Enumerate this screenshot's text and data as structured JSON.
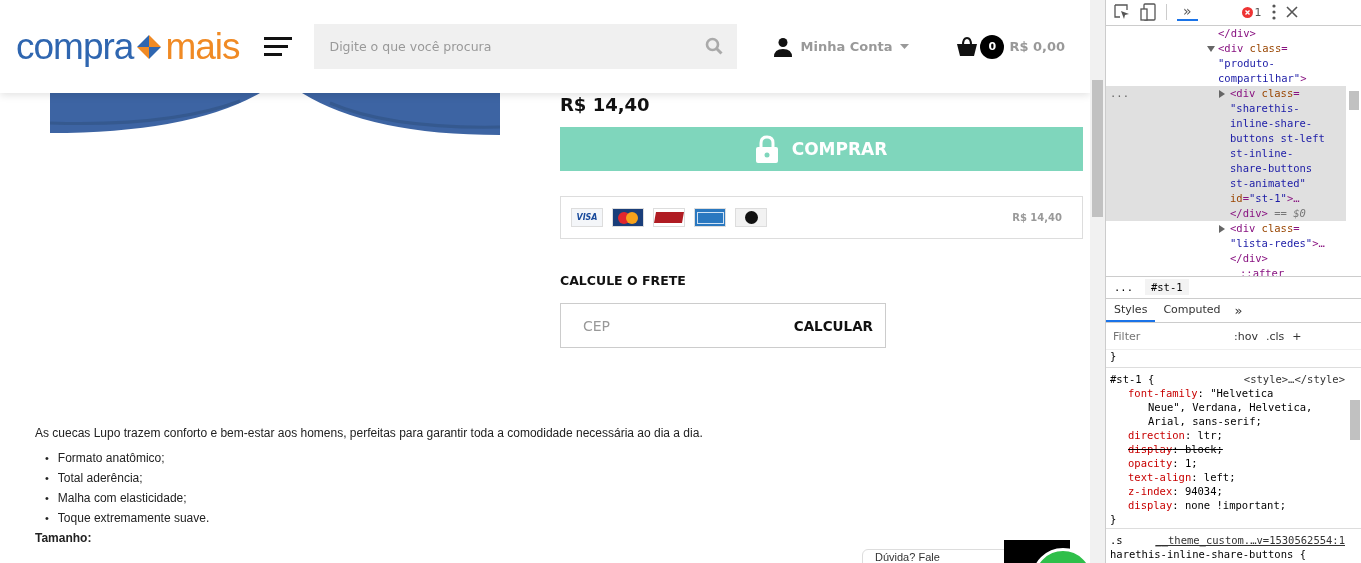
{
  "header": {
    "logo": {
      "left": "compra",
      "right": "mais"
    },
    "search": {
      "placeholder": "Digite o que você procura"
    },
    "account": {
      "label": "Minha Conta"
    },
    "cart": {
      "count": "0",
      "total": "R$ 0,00"
    }
  },
  "product": {
    "price": "R$ 14,40",
    "buy_button": "COMPRAR",
    "payment": {
      "cards": [
        {
          "kind": "visa",
          "label": "VISA"
        },
        {
          "kind": "mastercard"
        },
        {
          "kind": "hipercard"
        },
        {
          "kind": "amex"
        },
        {
          "kind": "elo"
        }
      ],
      "total": "R$ 14,40"
    },
    "shipping": {
      "title": "CALCULE O FRETE",
      "placeholder": "CEP",
      "button": "CALCULAR"
    }
  },
  "description": {
    "text": "As cuecas Lupo trazem conforto e bem-estar aos homens, perfeitas para garantir toda a comodidade necessária ao dia a dia.",
    "bullet": "•",
    "bullets": [
      "Formato anatômico;",
      "Total aderência;",
      "Malha com elasticidade;",
      "Toque extremamente suave."
    ],
    "size_label": "Tamanho:"
  },
  "chat": {
    "label": "Dúvida? Fale"
  },
  "devtools": {
    "more_tabs": "»",
    "error_count": "1",
    "row_menu": "...",
    "elements": [
      {
        "selected": false,
        "lines": [
          [
            {
              "kind": "tag",
              "t": "</div>"
            }
          ]
        ]
      },
      {
        "selected": false,
        "expanded": true,
        "lines": [
          [
            {
              "kind": "tag",
              "t": "<div "
            },
            {
              "kind": "attr",
              "t": "class"
            },
            {
              "kind": "tag",
              "t": "="
            }
          ],
          [
            {
              "kind": "val",
              "t": "\"produto-"
            }
          ],
          [
            {
              "kind": "val",
              "t": "compartilhar\""
            },
            {
              "kind": "tag",
              "t": ">"
            }
          ]
        ],
        "children": [
          {
            "selected": true,
            "expanded": false,
            "lines": [
              [
                {
                  "kind": "tag",
                  "t": "<div "
                },
                {
                  "kind": "attr",
                  "t": "class"
                },
                {
                  "kind": "tag",
                  "t": "="
                }
              ],
              [
                {
                  "kind": "val",
                  "t": "\"sharethis-"
                }
              ],
              [
                {
                  "kind": "val",
                  "t": "inline-share-"
                }
              ],
              [
                {
                  "kind": "val",
                  "t": "buttons st-left"
                }
              ],
              [
                {
                  "kind": "val",
                  "t": "st-inline-"
                }
              ],
              [
                {
                  "kind": "val",
                  "t": "share-buttons"
                }
              ],
              [
                {
                  "kind": "val",
                  "t": "st-animated\""
                }
              ],
              [
                {
                  "kind": "attr",
                  "t": "id"
                },
                {
                  "kind": "tag",
                  "t": "="
                },
                {
                  "kind": "val",
                  "t": "\"st-1\""
                },
                {
                  "kind": "tag",
                  "t": ">…"
                }
              ],
              [
                {
                  "kind": "tag",
                  "t": "</div>"
                },
                {
                  "kind": "dim",
                  "t": " == $0"
                }
              ]
            ]
          },
          {
            "selected": false,
            "expanded": false,
            "lines": [
              [
                {
                  "kind": "tag",
                  "t": "<div "
                },
                {
                  "kind": "attr",
                  "t": "class"
                },
                {
                  "kind": "tag",
                  "t": "="
                }
              ],
              [
                {
                  "kind": "val",
                  "t": "\"lista-redes\""
                },
                {
                  "kind": "tag",
                  "t": ">…"
                }
              ],
              [
                {
                  "kind": "tag",
                  "t": "</div>"
                }
              ]
            ]
          },
          {
            "selected": false,
            "lines": [
              [
                {
                  "kind": "pseudo",
                  "t": "::after"
                }
              ]
            ]
          }
        ]
      }
    ],
    "breadcrumb": [
      "...",
      "#st-1"
    ],
    "tabs": [
      {
        "label": "Styles",
        "selected": true
      },
      {
        "label": "Computed",
        "selected": false
      }
    ],
    "filter": {
      "placeholder": "Filter"
    },
    "filter_buttons": [
      ":hov",
      ".cls",
      "+"
    ],
    "prev_rule_end": "}",
    "rules": [
      {
        "selector": "#st-1 {",
        "source": "<style>…</style>",
        "props": [
          {
            "name": "font-family",
            "value": ": \"Helvetica",
            "cont": [
              "Neue\", Verdana, Helvetica,",
              "Arial, sans-serif;"
            ],
            "struck": false
          },
          {
            "name": "direction",
            "value": ": ltr;",
            "struck": false
          },
          {
            "name": "display",
            "value": ": block;",
            "struck": true
          },
          {
            "name": "opacity",
            "value": ": 1;",
            "struck": false
          },
          {
            "name": "text-align",
            "value": ": left;",
            "struck": false
          },
          {
            "name": "z-index",
            "value": ": 94034;",
            "struck": false
          },
          {
            "name": "display",
            "value": ": none !important;",
            "struck": false
          }
        ],
        "close": "}"
      }
    ],
    "next_rule": {
      "selector": ".s",
      "source": "__theme_custom.…v=1530562554:1",
      "line2": "harethis-inline-share-buttons {"
    }
  }
}
